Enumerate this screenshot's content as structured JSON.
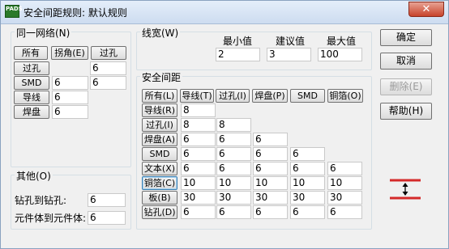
{
  "window": {
    "app_icon": "PADS",
    "title": "安全间距规则: 默认规则",
    "close_glyph": "✕"
  },
  "same_net": {
    "title": "同一网络(N)",
    "headers": [
      "所有",
      "拐角(E)",
      "过孔"
    ],
    "rows": [
      {
        "label": "过孔",
        "values": [
          "",
          "6"
        ]
      },
      {
        "label": "SMD",
        "values": [
          "6",
          "6"
        ]
      },
      {
        "label": "导线",
        "values": [
          "6"
        ]
      },
      {
        "label": "焊盘",
        "values": [
          "6"
        ]
      }
    ]
  },
  "other": {
    "title": "其他(O)",
    "rows": [
      {
        "label": "钻孔到钻孔:",
        "value": "6"
      },
      {
        "label": "元件体到元件体:",
        "value": "6"
      }
    ]
  },
  "width": {
    "title": "线宽(W)",
    "labels": [
      "最小值",
      "建议值",
      "最大值"
    ],
    "values": [
      "2",
      "3",
      "100"
    ]
  },
  "clearance": {
    "title": "安全间距",
    "col_headers": [
      "所有(L)",
      "导线(T)",
      "过孔(I)",
      "焊盘(P)",
      "SMD",
      "铜箔(O)"
    ],
    "rows": [
      {
        "label": "导线(R)",
        "values": [
          "8"
        ]
      },
      {
        "label": "过孔(I)",
        "values": [
          "8",
          "8"
        ]
      },
      {
        "label": "焊盘(A)",
        "values": [
          "6",
          "6",
          "6"
        ]
      },
      {
        "label": "SMD",
        "values": [
          "6",
          "6",
          "6",
          "6"
        ]
      },
      {
        "label": "文本(X)",
        "values": [
          "6",
          "6",
          "6",
          "6",
          "6"
        ]
      },
      {
        "label": "铜箔(C)",
        "values": [
          "10",
          "10",
          "10",
          "10",
          "10"
        ]
      },
      {
        "label": "板(B)",
        "values": [
          "30",
          "30",
          "30",
          "30",
          "30"
        ]
      },
      {
        "label": "钻孔(D)",
        "values": [
          "6",
          "6",
          "6",
          "6",
          "6"
        ]
      }
    ]
  },
  "buttons": {
    "ok": "确定",
    "cancel": "取消",
    "delete": "删除(E)",
    "help": "帮助(H)"
  },
  "icons": {
    "preview": "clearance-arrow-icon"
  },
  "colors": {
    "preview_line": "#d42a2a",
    "close_button": "#c7432a"
  }
}
